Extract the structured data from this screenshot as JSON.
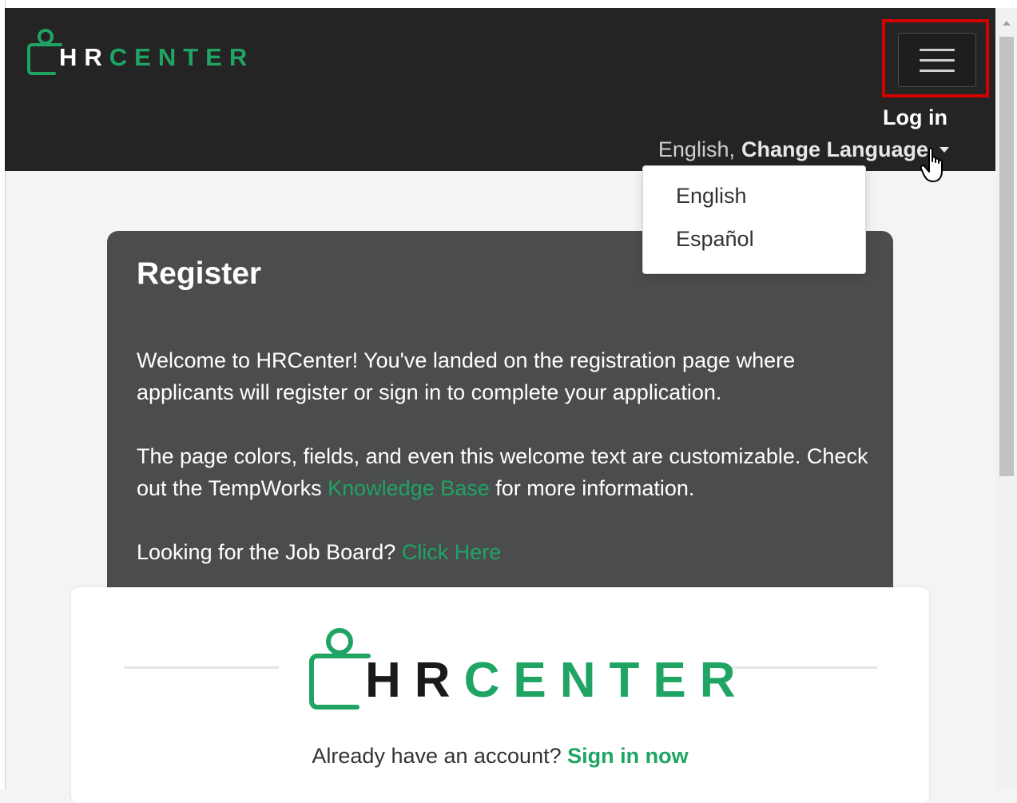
{
  "header": {
    "brand": {
      "part1": "HR",
      "part2": "CENTER"
    },
    "login_label": "Log in",
    "language": {
      "current": "English,",
      "toggle_label": "Change Language",
      "options": [
        "English",
        "Español"
      ]
    }
  },
  "register": {
    "title": "Register",
    "welcome": {
      "p1": "Welcome to HRCenter! You've landed on the registration page where applicants will register or sign in to complete your application.",
      "p2_before": "The page colors, fields, and even this welcome text are customizable. Check out the TempWorks ",
      "p2_link": "Knowledge Base",
      "p2_after": " for more information.",
      "p3_before": "Looking for the Job Board? ",
      "p3_link": "Click Here"
    }
  },
  "signin": {
    "brand": {
      "part1": "HR",
      "part2": "CENTER"
    },
    "prompt": "Already have an account? ",
    "link": "Sign in now"
  },
  "colors": {
    "header_bg": "#242424",
    "accent_green": "#1fa463",
    "card_bg": "#4b4c4e",
    "highlight_red": "#d40000"
  }
}
